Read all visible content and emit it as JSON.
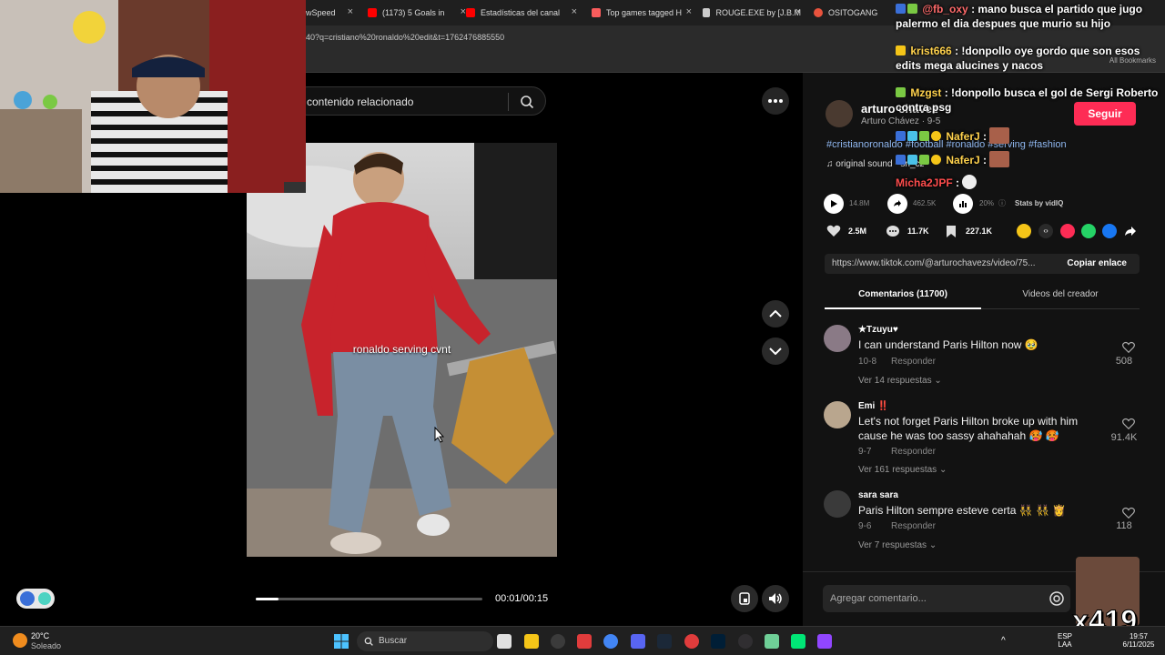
{
  "browser": {
    "tabs": [
      {
        "label": "wSpeed",
        "color": "#888888"
      },
      {
        "label": "(1173) 5 Goals in",
        "color": "#ff0000"
      },
      {
        "label": "Estadísticas del canal",
        "color": "#ff0000"
      },
      {
        "label": "Top games tagged H",
        "color": "#fa5c5c"
      },
      {
        "label": "ROUGE.EXE by [J.B.M",
        "color": "#cccccc"
      },
      {
        "label": "OSITOGANG",
        "color": "#e9533d"
      }
    ],
    "url": "40?q=cristiano%20ronaldo%20edit&t=1762476885550",
    "all_bookmarks": "All Bookmarks"
  },
  "search": {
    "placeholder": "contenido relacionado"
  },
  "video": {
    "caption": "ronaldo serving cvnt",
    "time": "00:01/00:15",
    "progress": 0.1
  },
  "post": {
    "author": "arturo chavez",
    "author_sub": "Arturo Chávez · 9-5",
    "follow_label": "Seguir",
    "hashtags": "#cristianoronaldo #football #ronaldo #serving #fashion",
    "sound": "original sound - sn_cz",
    "views": "14.8M",
    "shares_stat": "462.5K",
    "stat_pct": "20%",
    "stats_by": "Stats by vidIQ",
    "likes": "2.5M",
    "comments": "11.7K",
    "saves": "227.1K",
    "link": "https://www.tiktok.com/@arturochavezs/video/75...",
    "copy_label": "Copiar enlace",
    "tab_comments": "Comentarios (11700)",
    "tab_videos": "Videos del creador"
  },
  "comments": [
    {
      "user": "★Tzuyu♥",
      "text": "I can understand Paris Hilton now 🥹",
      "date": "10-8",
      "reply": "Responder",
      "more": "Ver 14 respuestas ⌄",
      "likes": "508",
      "avatar": "#8a7a86"
    },
    {
      "user": "Emi ‼️",
      "text": "Let's not forget Paris Hilton broke up with him cause he was too sassy ahahahah 🥵 🥵",
      "date": "9-7",
      "reply": "Responder",
      "more": "Ver 161 respuestas ⌄",
      "likes": "91.4K",
      "avatar": "#b9a68e"
    },
    {
      "user": "sara sara",
      "text": "Paris Hilton sempre esteve certa 👯‍♀️ 👯‍♀️ 👸",
      "date": "9-6",
      "reply": "Responder",
      "more": "Ver 7 respuestas ⌄",
      "likes": "118",
      "avatar": "#3a3a3a"
    }
  ],
  "add_comment": {
    "placeholder": "Agregar comentario..."
  },
  "chat": [
    {
      "user": "@fb_oxy",
      "text": ": mano busca el partido que jugo palermo el dia despues que murio su hijo"
    },
    {
      "user": "krist666",
      "text": ": !donpollo oye gordo que son esos edits mega alucines y nacos"
    },
    {
      "user": "Mzgst",
      "text": ": !donpollo busca el gol de Sergi Roberto contra psg"
    },
    {
      "user": "NaferJ",
      "text": ":"
    },
    {
      "user": "NaferJ",
      "text": ":"
    },
    {
      "user": "Micha2JPF",
      "text": ":"
    }
  ],
  "emote_text": "x419",
  "taskbar": {
    "temp": "20°C",
    "weather": "Soleado",
    "search": "Buscar",
    "lang_top": "ESP",
    "lang_bottom": "LAA",
    "time": "19:57",
    "date": "6/11/2025"
  }
}
